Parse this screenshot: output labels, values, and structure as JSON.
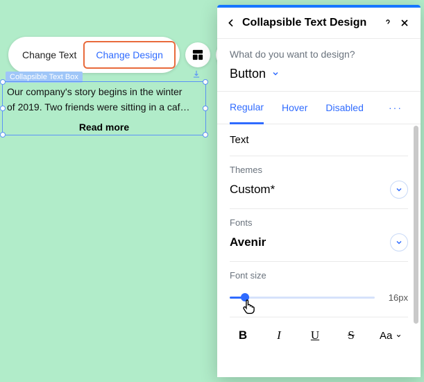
{
  "context_toolbar": {
    "change_text": "Change Text",
    "change_design": "Change Design"
  },
  "component": {
    "badge": "Collapsible Text Box",
    "line1": "Our company's story begins in the winter",
    "line2": "of 2019. Two friends were sitting in a caf…",
    "read_more": "Read more"
  },
  "panel": {
    "title": "Collapsible Text Design",
    "what_prompt": "What do you want to design?",
    "target": "Button",
    "tabs": {
      "regular": "Regular",
      "hover": "Hover",
      "disabled": "Disabled",
      "more": "···"
    },
    "text_section": "Text",
    "themes": {
      "label": "Themes",
      "value": "Custom*"
    },
    "fonts": {
      "label": "Fonts",
      "value": "Avenir"
    },
    "font_size": {
      "label": "Font size",
      "value": "16px"
    },
    "format": {
      "bold": "B",
      "italic": "I",
      "underline": "U",
      "strike": "S",
      "case": "Aa"
    }
  }
}
